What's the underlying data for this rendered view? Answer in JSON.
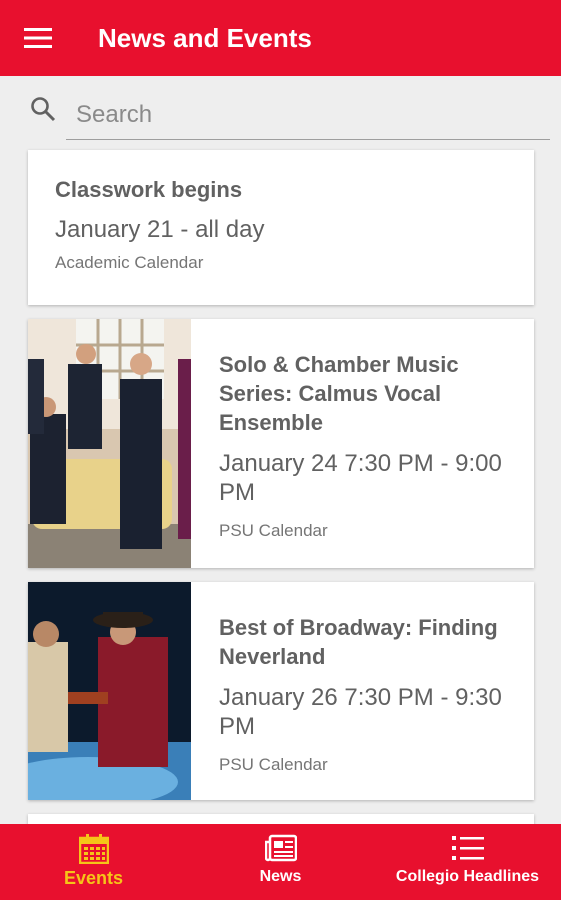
{
  "app_bar": {
    "title": "News and Events",
    "menu_icon": "hamburger-icon"
  },
  "search": {
    "placeholder": "Search",
    "value": ""
  },
  "events": [
    {
      "title": "Classwork begins",
      "time": "January 21 - all day",
      "calendar": "Academic Calendar"
    },
    {
      "title": "Solo & Chamber Music Series: Calmus Vocal Ensemble",
      "time": "January 24 7:30 PM - 9:00 PM",
      "calendar": "PSU Calendar"
    },
    {
      "title": "Best of Broadway: Finding Neverland",
      "time": "January 26 7:30 PM - 9:30 PM",
      "calendar": "PSU Calendar"
    }
  ],
  "bottom_nav": [
    {
      "label": "Events",
      "icon": "calendar-icon",
      "active": true
    },
    {
      "label": "News",
      "icon": "newspaper-icon",
      "active": false
    },
    {
      "label": "Collegio Headlines",
      "icon": "list-icon",
      "active": false
    }
  ],
  "colors": {
    "brand_red": "#e8102e",
    "active_tab": "#f5c518",
    "text_gray": "#616161"
  }
}
